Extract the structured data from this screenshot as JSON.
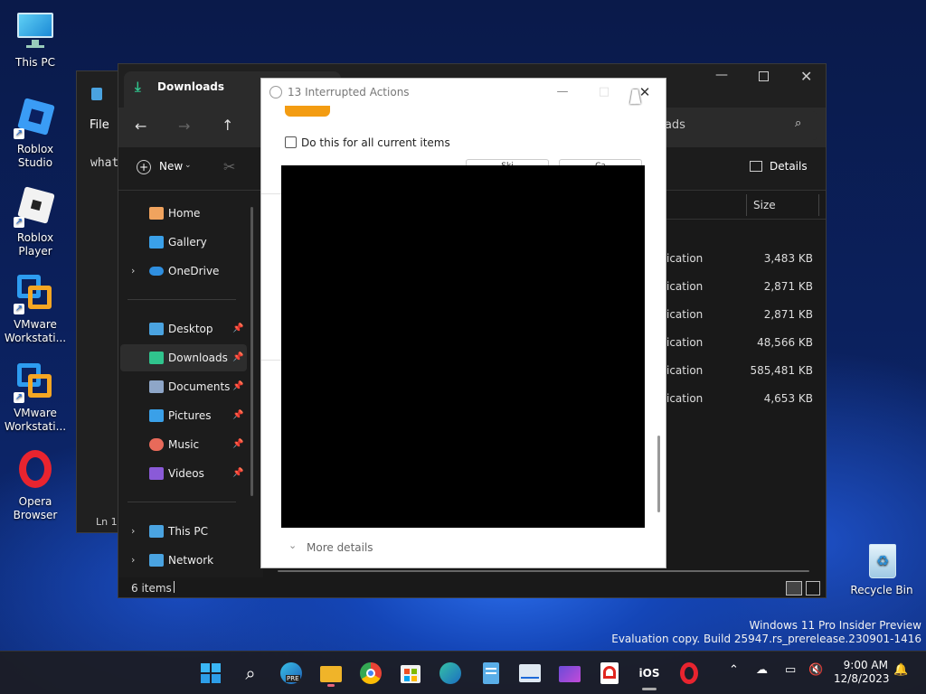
{
  "desktop": {
    "icons": [
      {
        "label": "This PC",
        "icon": "monitor-icon"
      },
      {
        "label": "Roblox Studio",
        "icon": "roblox-studio-icon"
      },
      {
        "label": "Roblox Player",
        "icon": "roblox-player-icon"
      },
      {
        "label": "VMware Workstati...",
        "icon": "vmware-icon"
      },
      {
        "label": "VMware Workstati...",
        "icon": "vmware-icon"
      },
      {
        "label": "Opera Browser",
        "icon": "opera-icon"
      },
      {
        "label": "Recycle Bin",
        "icon": "recycle-bin-icon"
      }
    ],
    "watermark": {
      "line1": "Windows 11 Pro Insider Preview",
      "line2": "Evaluation copy. Build 25947.rs_prerelease.230901-1416"
    }
  },
  "notepad": {
    "menu_file": "File",
    "text": "what",
    "status": "Ln 1,"
  },
  "explorer": {
    "tab_title": "Downloads",
    "search_placeholder": "oads",
    "new_label": "New",
    "details_label": "Details",
    "column_size": "Size",
    "sidebar": [
      {
        "label": "Home",
        "icon": "home-icon",
        "color": "#f0a35e"
      },
      {
        "label": "Gallery",
        "icon": "gallery-icon",
        "color": "#3aa0e8"
      },
      {
        "label": "OneDrive",
        "icon": "cloud-icon",
        "color": "#2f8fe0"
      },
      {
        "label": "Desktop",
        "icon": "desktop-icon",
        "color": "#4aa3e0"
      },
      {
        "label": "Downloads",
        "icon": "download-icon",
        "color": "#30c48d"
      },
      {
        "label": "Documents",
        "icon": "document-icon",
        "color": "#8ea6c8"
      },
      {
        "label": "Pictures",
        "icon": "pictures-icon",
        "color": "#3aa0e8"
      },
      {
        "label": "Music",
        "icon": "music-icon",
        "color": "#e86a5a"
      },
      {
        "label": "Videos",
        "icon": "video-icon",
        "color": "#8a5ad8"
      },
      {
        "label": "This PC",
        "icon": "monitor-icon",
        "color": "#4aa3e0"
      },
      {
        "label": "Network",
        "icon": "network-icon",
        "color": "#4aa3e0"
      }
    ],
    "rows": [
      {
        "type": "ication",
        "size": "3,483 KB"
      },
      {
        "type": "ication",
        "size": "2,871 KB"
      },
      {
        "type": "ication",
        "size": "2,871 KB"
      },
      {
        "type": "ication",
        "size": "48,566 KB"
      },
      {
        "type": "ication",
        "size": "585,481 KB"
      },
      {
        "type": "ication",
        "size": "4,653 KB"
      }
    ],
    "status_items": "6 items"
  },
  "dialog": {
    "title": "13 Interrupted Actions",
    "checkbox_label": "Do this for all current items",
    "button1": "Ski",
    "button2": "Ca",
    "more_details": "More details"
  },
  "taskbar": {
    "apps": [
      "start-icon",
      "search-icon",
      "edge-beta-icon",
      "file-explorer-icon",
      "chrome-icon",
      "store-icon",
      "edge-icon",
      "notepad-icon",
      "task-manager-icon",
      "clipchamp-icon",
      "acrobat-icon",
      "ios-icon",
      "opera-icon"
    ],
    "ios_label": "iOS",
    "edge_beta_badge": "PRE",
    "time": "9:00 AM",
    "date": "12/8/2023"
  },
  "colors": {
    "accent": "#0067c0",
    "folder": "#f0b429",
    "download_green": "#30c48d",
    "orange": "#f39c12"
  }
}
